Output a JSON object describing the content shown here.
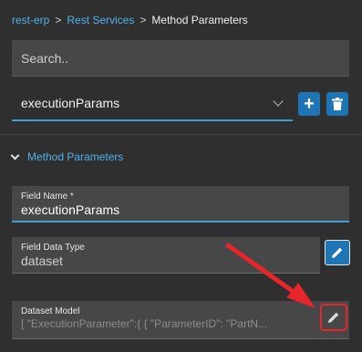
{
  "breadcrumb": {
    "items": [
      "rest-erp",
      "Rest Services"
    ],
    "separator": ">",
    "current": "Method Parameters"
  },
  "search": {
    "placeholder": "Search.."
  },
  "selector": {
    "value": "executionParams"
  },
  "toolbar": {
    "add_icon": "plus-icon",
    "delete_icon": "trash-icon"
  },
  "section": {
    "title": "Method Parameters",
    "expanded": true
  },
  "fields": {
    "name": {
      "label": "Field Name *",
      "value": "executionParams"
    },
    "type": {
      "label": "Field Data Type",
      "value": "dataset"
    },
    "model": {
      "label": "Dataset Model",
      "value": "[  \"ExecutionParameter\":{   {     \"ParameterID\": \"PartN..."
    }
  },
  "colors": {
    "accent": "#1f74b4",
    "link": "#4fb3e8",
    "annotation": "#e8252a"
  }
}
